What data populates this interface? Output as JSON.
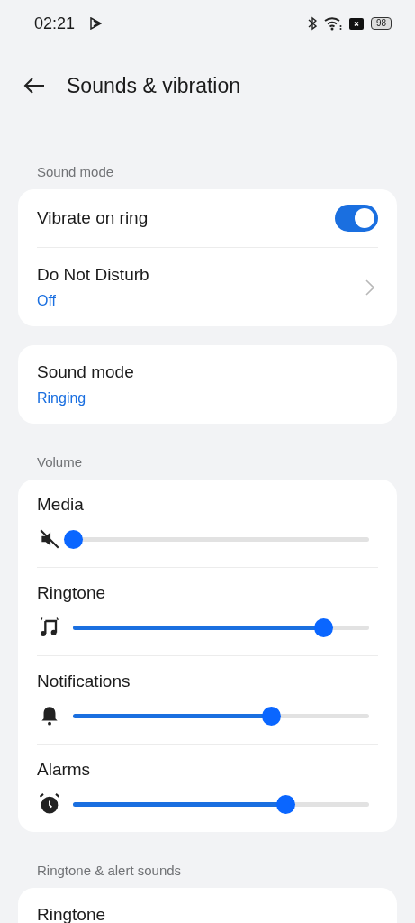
{
  "status_bar": {
    "time": "02:21",
    "battery": "98"
  },
  "header": {
    "title": "Sounds & vibration"
  },
  "sections": [
    {
      "label": "Sound mode",
      "cards": [
        [
          {
            "kind": "toggle",
            "title": "Vibrate on ring",
            "on": true
          },
          {
            "kind": "nav",
            "title": "Do Not Disturb",
            "value": "Off"
          }
        ],
        [
          {
            "kind": "value",
            "title": "Sound mode",
            "value": "Ringing"
          }
        ]
      ]
    },
    {
      "label": "Volume",
      "cards": [
        [
          {
            "kind": "slider",
            "title": "Media",
            "level": 0
          },
          {
            "kind": "slider",
            "title": "Ringtone",
            "level": 0.87
          },
          {
            "kind": "slider",
            "title": "Notifications",
            "level": 0.69
          },
          {
            "kind": "slider",
            "title": "Alarms",
            "level": 0.74
          }
        ]
      ]
    },
    {
      "label": "Ringtone & alert sounds",
      "cards": [
        [
          {
            "kind": "value",
            "title": "Ringtone"
          }
        ]
      ]
    }
  ]
}
